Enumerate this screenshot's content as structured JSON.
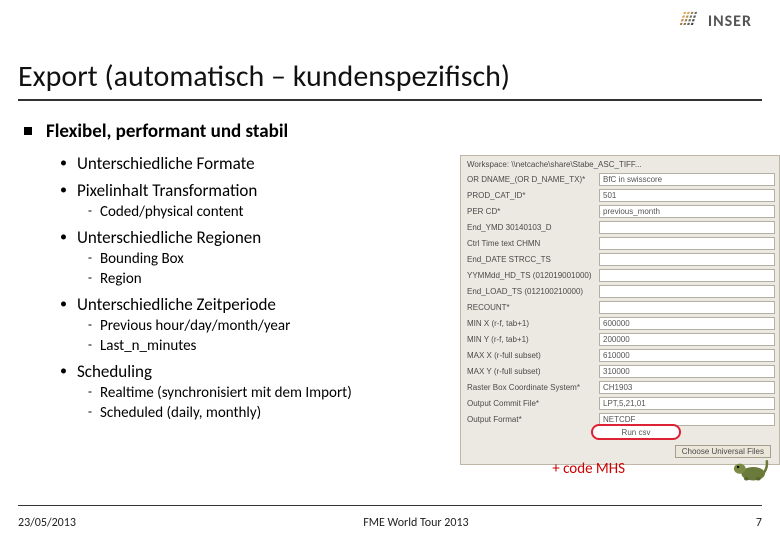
{
  "logo": {
    "text": "INSER"
  },
  "title": "Export (automatisch – kundenspezifisch)",
  "content": {
    "h1": "Flexibel, performant und stabil",
    "formats": "Unterschiedliche Formate",
    "pixel": "Pixelinhalt Transformation",
    "pixel_sub1": "Coded/physical content",
    "regions": "Unterschiedliche Regionen",
    "regions_sub1": "Bounding Box",
    "regions_sub2": "Region",
    "period": "Unterschiedliche Zeitperiode",
    "period_sub1": "Previous hour/day/month/year",
    "period_sub2": "Last_n_minutes",
    "scheduling": "Scheduling",
    "scheduling_sub1": "Realtime (synchronisiert mit dem Import)",
    "scheduling_sub2": "Scheduled (daily, monthly)"
  },
  "form": {
    "title": "Workspace: \\\\netcache\\share\\Stabe_ASC_TIFF...",
    "rows": [
      {
        "label": "OR DNAME_(OR D_NAME_TX)*",
        "value": "BfC in swisscore"
      },
      {
        "label": "PROD_CAT_ID*",
        "value": "501"
      },
      {
        "label": "PER CD*",
        "value": "previous_month"
      },
      {
        "label": "End_YMD 30140103_D",
        "value": ""
      },
      {
        "label": "Ctrl Time text CHMN",
        "value": ""
      },
      {
        "label": "End_DATE STRCC_TS",
        "value": ""
      },
      {
        "label": "YYMMdd_HD_TS (012019001000)",
        "value": ""
      },
      {
        "label": "End_LOAD_TS (012100210000)",
        "value": ""
      },
      {
        "label": "RECOUNT*",
        "value": ""
      },
      {
        "label": "MIN X (r-f, tab+1)",
        "value": "600000"
      },
      {
        "label": "MIN Y (r-f, tab+1)",
        "value": "200000"
      },
      {
        "label": "MAX X (r-full subset)",
        "value": "610000"
      },
      {
        "label": "MAX Y (r-full subset)",
        "value": "310000"
      },
      {
        "label": "Raster Box Coordinate System*",
        "value": "CH1903"
      },
      {
        "label": "Output Commit File*",
        "value": "LPT,5,21,01"
      },
      {
        "label": "Output Format*",
        "value": "NETCDF"
      }
    ],
    "highlight": "Run csv",
    "button": "Choose Universal Files"
  },
  "additional": "+ code MHS",
  "footer": {
    "date": "23/05/2013",
    "center": "FME World Tour 2013",
    "page": "7"
  }
}
